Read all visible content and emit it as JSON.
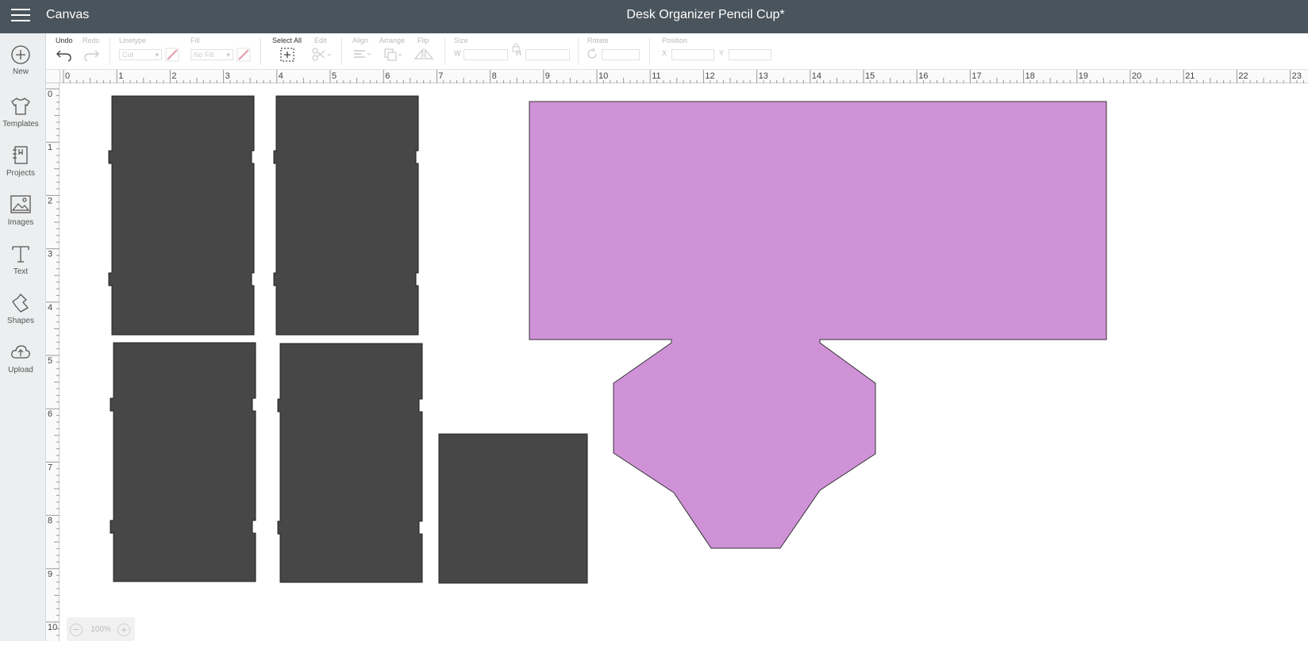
{
  "header": {
    "app_name": "Canvas",
    "doc_title": "Desk Organizer Pencil Cup*"
  },
  "sidebar": {
    "items": [
      {
        "label": "New",
        "icon": "plus-circle-icon"
      },
      {
        "label": "Templates",
        "icon": "tshirt-icon"
      },
      {
        "label": "Projects",
        "icon": "notebook-icon"
      },
      {
        "label": "Images",
        "icon": "image-icon"
      },
      {
        "label": "Text",
        "icon": "text-t-icon"
      },
      {
        "label": "Shapes",
        "icon": "shapes-icon"
      },
      {
        "label": "Upload",
        "icon": "cloud-upload-icon"
      }
    ]
  },
  "toolbar": {
    "undo": "Undo",
    "redo": "Redo",
    "linetype": "Linetype",
    "linetype_value": "Cut",
    "fill": "Fill",
    "fill_value": "No Fill",
    "select_all": "Select All",
    "edit": "Edit",
    "align": "Align",
    "arrange": "Arrange",
    "flip": "Flip",
    "size": "Size",
    "w": "W",
    "h": "H",
    "rotate": "Rotate",
    "position": "Position",
    "x": "X",
    "y": "Y"
  },
  "ruler": {
    "h_labels": [
      "0",
      "1",
      "2",
      "3",
      "4",
      "5",
      "6",
      "7",
      "8",
      "9",
      "10",
      "11",
      "12",
      "13",
      "14",
      "15",
      "16",
      "17",
      "18",
      "19",
      "20",
      "21",
      "22",
      "23"
    ],
    "v_labels": [
      "0",
      "1",
      "2",
      "3",
      "4",
      "5",
      "6",
      "7",
      "8",
      "9",
      "10"
    ]
  },
  "canvas": {
    "shape_colors": {
      "dark": "#474747",
      "purple": "#cf92d7"
    }
  },
  "zoom": {
    "value": "100%"
  }
}
